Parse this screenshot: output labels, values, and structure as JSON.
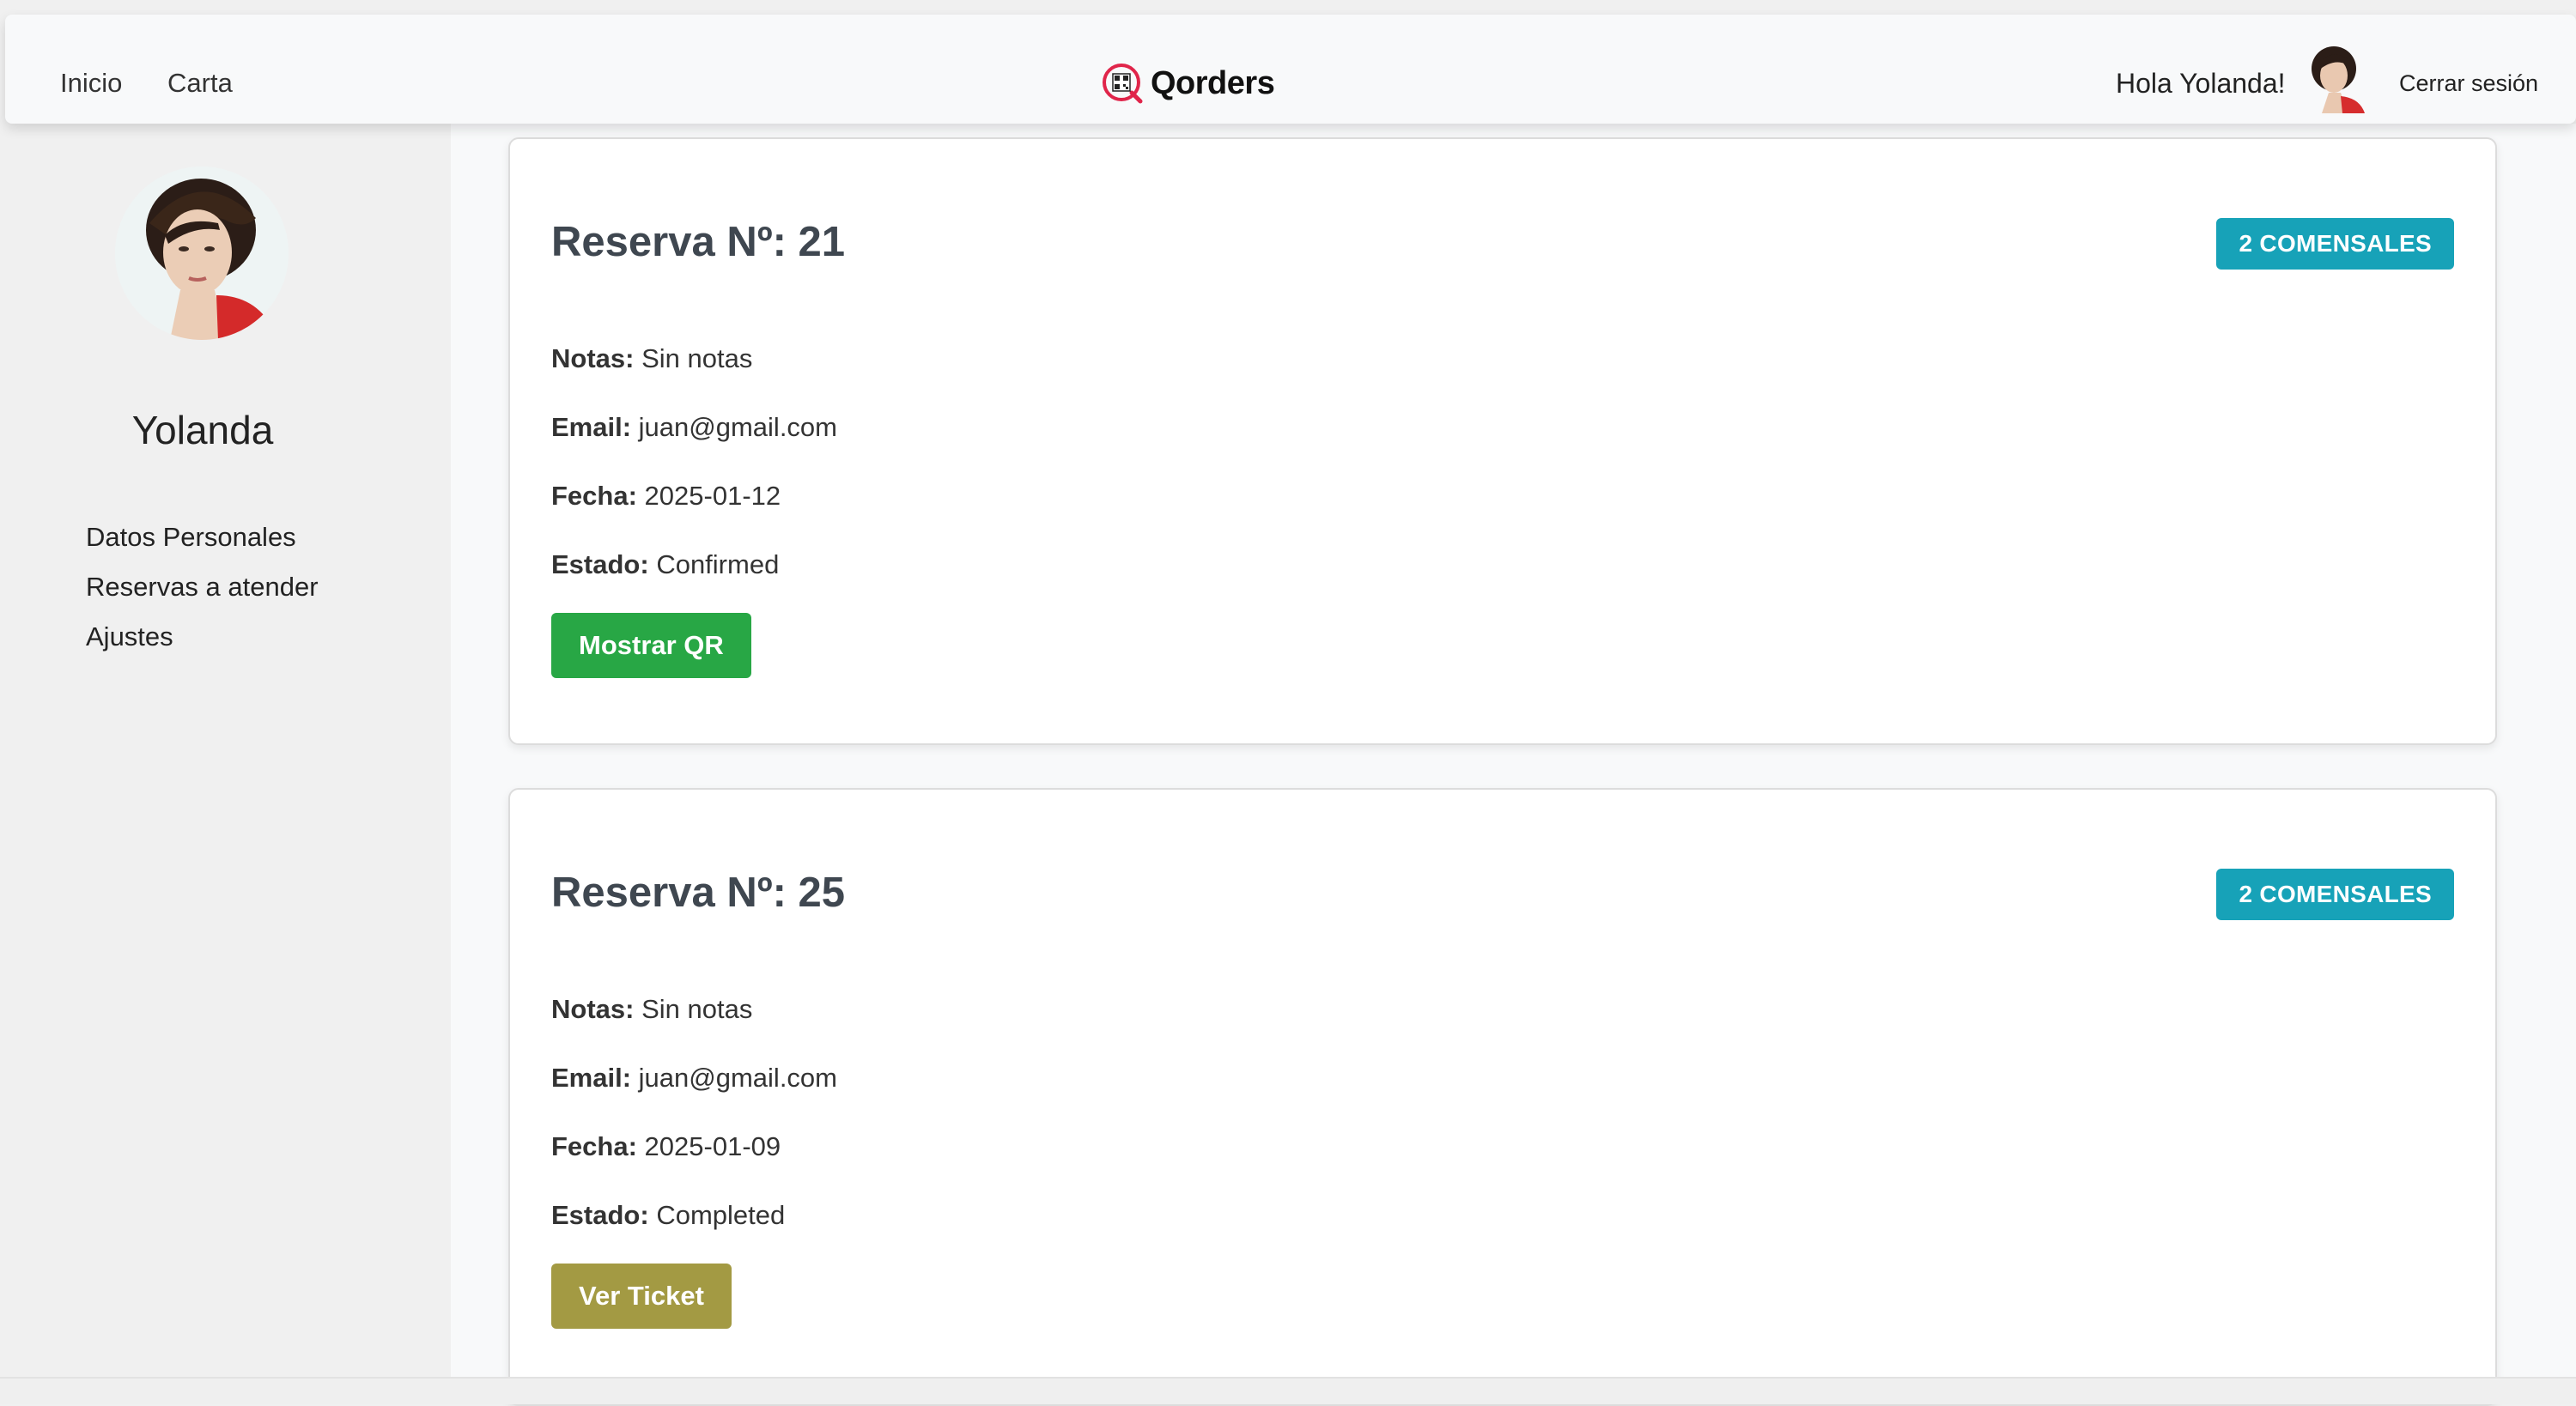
{
  "nav": {
    "links": [
      "Inicio",
      "Carta"
    ],
    "brand": "Qorders",
    "greeting": "Hola Yolanda!",
    "logout": "Cerrar sesión"
  },
  "sidebar": {
    "name": "Yolanda",
    "items": [
      "Datos Personales",
      "Reservas a atender",
      "Ajustes"
    ]
  },
  "reservations": [
    {
      "title": "Reserva Nº: 21",
      "badge": "2 COMENSALES",
      "notes_label": "Notas:",
      "notes": "Sin notas",
      "email_label": "Email:",
      "email": "juan@gmail.com",
      "date_label": "Fecha:",
      "date": "2025-01-12",
      "status_label": "Estado:",
      "status": "Confirmed",
      "button": "Mostrar QR"
    },
    {
      "title": "Reserva Nº: 25",
      "badge": "2 COMENSALES",
      "notes_label": "Notas:",
      "notes": "Sin notas",
      "email_label": "Email:",
      "email": "juan@gmail.com",
      "date_label": "Fecha:",
      "date": "2025-01-09",
      "status_label": "Estado:",
      "status": "Completed",
      "button": "Ver Ticket"
    }
  ],
  "colors": {
    "badge": "#17a2b8",
    "qr_button": "#28a745",
    "ticket_button": "#a39a43",
    "brand_accent": "#e0254a"
  }
}
